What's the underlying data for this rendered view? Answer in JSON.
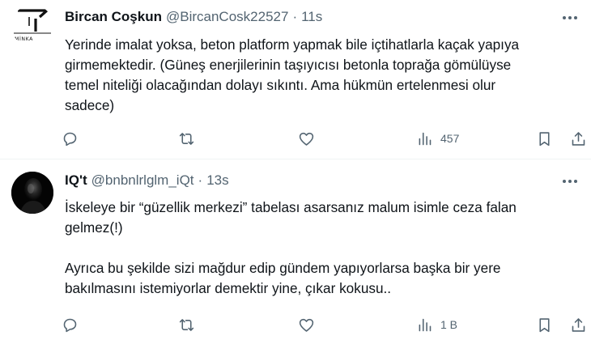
{
  "tweets": [
    {
      "author": {
        "name": "Bircan Coşkun",
        "handle": "@BircanCosk22527",
        "avatar_logo_text": "MİNKA"
      },
      "separator": "·",
      "time": "11s",
      "text_lines": [
        "Yerinde imalat yoksa, beton platform yapmak bile içtihatlarla kaçak yapıya",
        "girmemektedir. (Güneş enerjilerinin taşıyıcısı betonla  toprağa gömülüyse",
        "temel niteliği olacağından dolayı sıkıntı. Ama hükmün ertelenmesi olur",
        "sadece)"
      ],
      "actions": {
        "reply_icon": "reply-icon",
        "retweet_icon": "retweet-icon",
        "like_icon": "heart-icon",
        "views_icon": "views-icon",
        "views": "457",
        "bookmark_icon": "bookmark-icon",
        "share_icon": "share-icon"
      }
    },
    {
      "author": {
        "name": "IQ't",
        "handle": "@bnbnlrlglm_iQt"
      },
      "separator": "·",
      "time": "13s",
      "paragraphs": [
        [
          "İskeleye bir “güzellik merkezi” tabelası asarsanız malum isimle ceza falan",
          "gelmez(!)"
        ],
        [
          "Ayrıca bu şekilde sizi mağdur edip gündem yapıyorlarsa başka bir yere",
          "bakılmasını istemiyorlar demektir yine, çıkar kokusu.."
        ]
      ],
      "actions": {
        "reply_icon": "reply-icon",
        "retweet_icon": "retweet-icon",
        "like_icon": "heart-icon",
        "views_icon": "views-icon",
        "views": "1 B",
        "bookmark_icon": "bookmark-icon",
        "share_icon": "share-icon"
      }
    }
  ],
  "colors": {
    "text": "#0f1419",
    "secondary": "#536471",
    "divider": "#eff3f4",
    "background": "#ffffff"
  }
}
